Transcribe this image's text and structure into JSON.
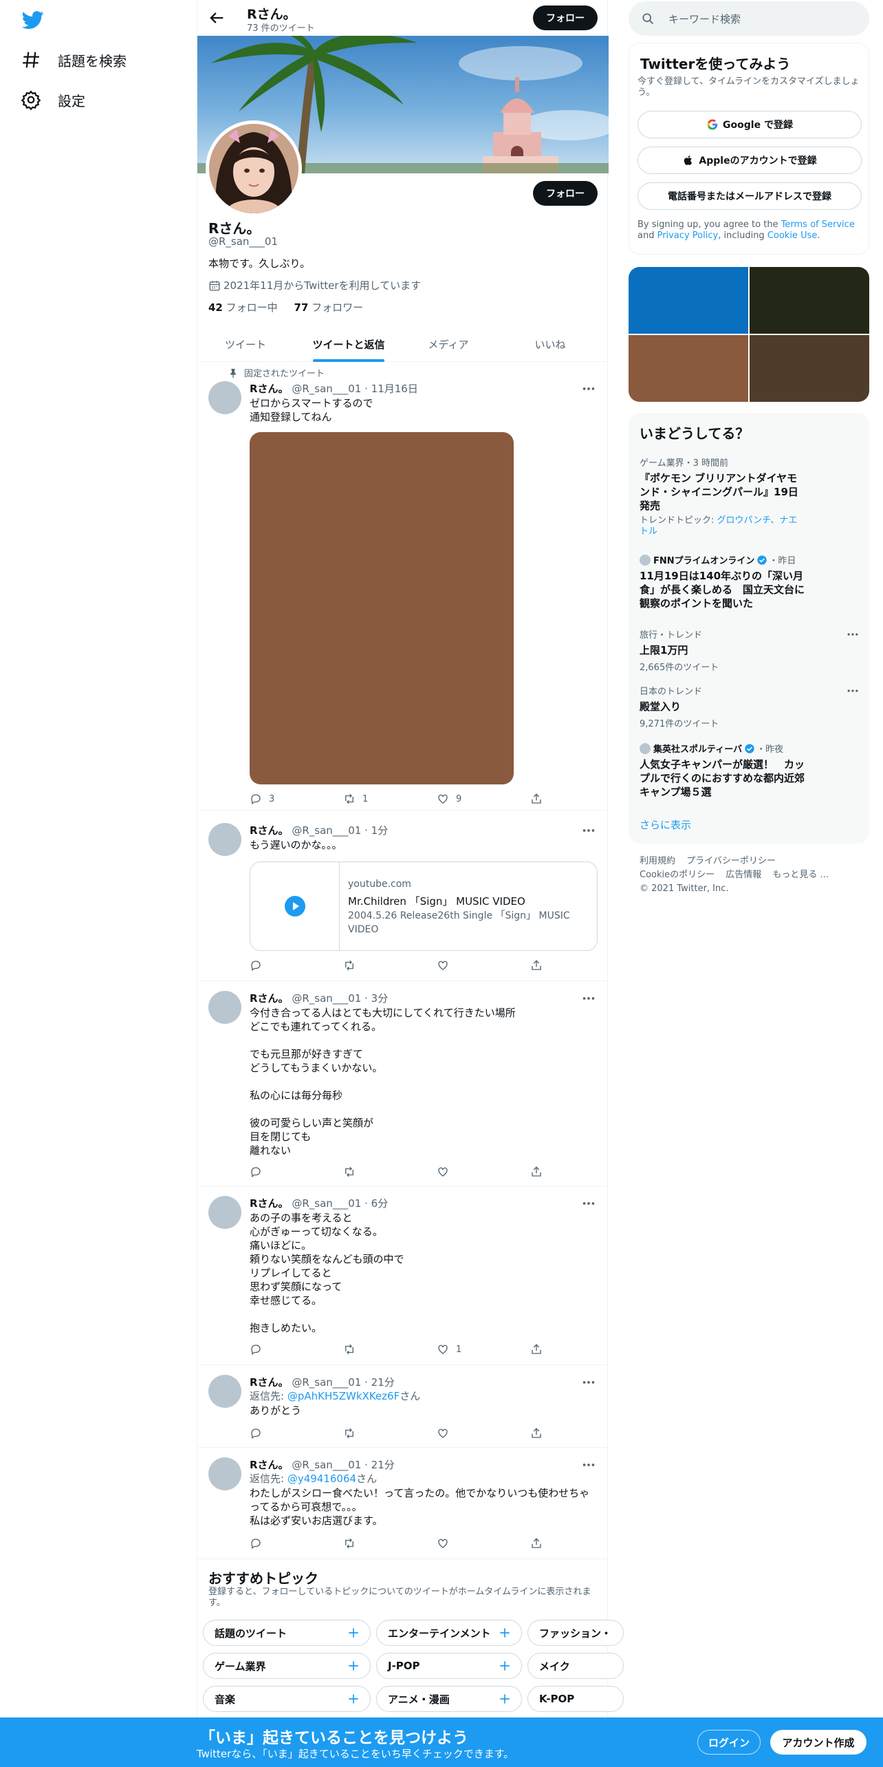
{
  "nav": {
    "explore": "話題を検索",
    "settings": "設定"
  },
  "header": {
    "name": "Rさん。",
    "tweet_count": "73 件のツイート",
    "follow": "フォロー"
  },
  "profile": {
    "name": "Rさん。",
    "handle": "@R_san___01",
    "bio": "本物です。久しぶり。",
    "joined": "2021年11月からTwitterを利用しています",
    "following_count": "42",
    "following_label": "フォロー中",
    "followers_count": "77",
    "followers_label": "フォロワー",
    "follow": "フォロー"
  },
  "tabs": [
    "ツイート",
    "ツイートと返信",
    "メディア",
    "いいね"
  ],
  "pinned_label": "固定されたツイート",
  "tweets": [
    {
      "name": "Rさん。",
      "meta": "@R_san___01 · 11月16日",
      "text": "ゼロからスマートするので\n通知登録してねん",
      "replies": "3",
      "retweets": "1",
      "likes": "9"
    },
    {
      "name": "Rさん。",
      "meta": "@R_san___01 · 1分",
      "text": "もう遅いのかな。。。",
      "replies": "",
      "retweets": "",
      "likes": ""
    },
    {
      "name": "Rさん。",
      "meta": "@R_san___01 · 3分",
      "text": "今付き合ってる人はとても大切にしてくれて行きたい場所\nどこでも連れてってくれる。\n\nでも元旦那が好きすぎて\nどうしてもうまくいかない。\n\n私の心には毎分毎秒\n\n彼の可愛らしい声と笑顔が\n目を閉じても\n離れない",
      "replies": "",
      "retweets": "",
      "likes": ""
    },
    {
      "name": "Rさん。",
      "meta": "@R_san___01 · 6分",
      "text": "あの子の事を考えると\n心がぎゅーって切なくなる。\n痛いほどに。\n頼りない笑顔をなんども頭の中で\nリプレイしてると\n思わず笑顔になって\n幸せ感じてる。\n\n抱きしめたい。",
      "replies": "",
      "retweets": "",
      "likes": "1"
    },
    {
      "name": "Rさん。",
      "meta": "@R_san___01 · 21分",
      "reply_prefix": "返信先: ",
      "reply_to": "@pAhKH5ZWkXKez6F",
      "reply_suffix": "さん",
      "text": "ありがとう",
      "replies": "",
      "retweets": "",
      "likes": ""
    },
    {
      "name": "Rさん。",
      "meta": "@R_san___01 · 21分",
      "reply_prefix": "返信先: ",
      "reply_to": "@y49416064",
      "reply_suffix": "さん",
      "text": "わたしがスシロー食べたい！って言ったの。他でかなりいつも使わせちゃってるから可哀想で。。。\n私は必ず安いお店選びます。",
      "replies": "",
      "retweets": "",
      "likes": ""
    }
  ],
  "media_color": "#8a5a3e",
  "card": {
    "domain": "youtube.com",
    "title": "Mr.Children 「Sign」 MUSIC VIDEO",
    "description": "2004.5.26 Release26th Single 「Sign」 MUSIC VIDEO"
  },
  "topics": {
    "title": "おすすめトピック",
    "subtitle": "登録すると、フォローしているトピックについてのツイートがホームタイムラインに表示されます。",
    "chips": [
      "話題のツイート",
      "エンターテインメント",
      "ファッション・",
      "ゲーム業界",
      "J-POP",
      "メイク",
      "音楽",
      "アニメ・漫画",
      "K-POP"
    ]
  },
  "search": {
    "placeholder": "キーワード検索"
  },
  "signup_box": {
    "title": "Twitterを使ってみよう",
    "subtitle": "今すぐ登録して、タイムラインをカスタマイズしましょう。",
    "google": "Google で登録",
    "apple": "Appleのアカウントで登録",
    "phone": "電話番号またはメールアドレスで登録",
    "terms_1": "By signing up, you agree to the ",
    "terms_link": "Terms of Service",
    "terms_2": " and ",
    "privacy_link": "Privacy Policy",
    "terms_3": ", including ",
    "cookie_link": "Cookie Use",
    "terms_4": "."
  },
  "media_grid": [
    "#0a6fbe",
    "#222718",
    "#8a5a3e",
    "#4f3c2a"
  ],
  "trends": {
    "title": "いまどうしてる？",
    "items": [
      {
        "meta": "ゲーム業界・3 時間前",
        "title": "『ポケモン ブリリアントダイヤモンド・シャイニングパール』19日発売",
        "topics_label": "トレンドトピック: ",
        "topics_link": "グロウパンチ、ナエトル"
      },
      {
        "source": "FNNプライムオンライン",
        "time": "・昨日",
        "title": "11月19日は140年ぶりの「深い月食」が長く楽しめる　国立天文台に観察のポイントを聞いた"
      },
      {
        "meta": "旅行・トレンド",
        "title": "上限1万円",
        "count": "2,665件のツイート"
      },
      {
        "meta": "日本のトレンド",
        "title": "殿堂入り",
        "count": "9,271件のツイート"
      },
      {
        "source": "集英社スポルティーバ",
        "time": "・昨夜",
        "title": "人気女子キャンパーが厳選！　カップルで行くのにおすすめな都内近郊キャンプ場５選"
      }
    ],
    "show_more": "さらに表示"
  },
  "footer": {
    "links": [
      "利用規約",
      "プライバシーポリシー",
      "Cookieのポリシー",
      "広告情報",
      "もっと見る ..."
    ],
    "copyright": "© 2021 Twitter, Inc."
  },
  "bottom": {
    "title": "「いま」起きていることを見つけよう",
    "subtitle": "Twitterなら、「いま」起きていることをいち早くチェックできます。",
    "login": "ログイン",
    "signup": "アカウント作成"
  }
}
